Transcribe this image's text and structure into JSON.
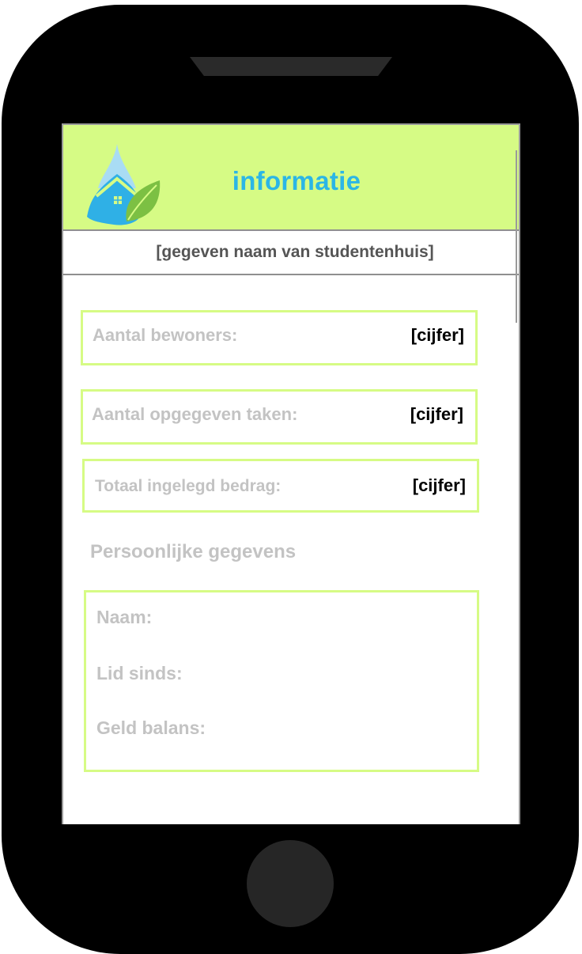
{
  "app": {
    "title": "informatie",
    "house_name": "[gegeven naam van studentenhuis]"
  },
  "stats": [
    {
      "label": "Aantal bewoners:",
      "value": "[cijfer]"
    },
    {
      "label": "Aantal opgegeven taken:",
      "value": "[cijfer]"
    },
    {
      "label": "Totaal ingelegd bedrag:",
      "value": "[cijfer]"
    }
  ],
  "personal": {
    "section_title": "Persoonlijke gegevens",
    "fields": [
      {
        "label": "Naam:"
      },
      {
        "label": "Lid sinds:"
      },
      {
        "label": "Geld balans:"
      }
    ]
  },
  "icons": {
    "logo": "house-droplet-leaf-logo"
  },
  "colors": {
    "header_bg": "#d6fb85",
    "title": "#2bb6e6",
    "box_border": "#d6fb85",
    "muted_text": "#c3c3c3",
    "phone_body": "#000000"
  }
}
